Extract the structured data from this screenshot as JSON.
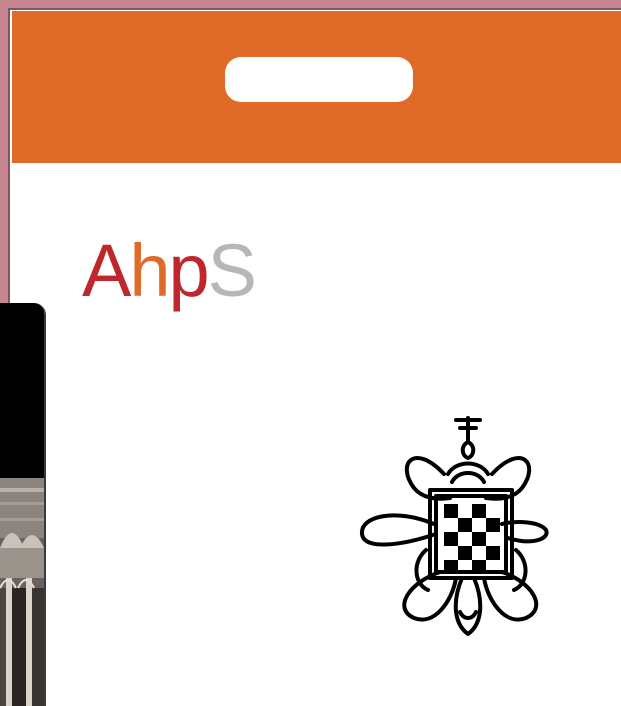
{
  "colors": {
    "page_border": "#c5868f",
    "header_band": "#e06a27",
    "logo_red": "#c0272d",
    "logo_orange": "#e06a27",
    "logo_gray": "#b7b7b7"
  },
  "logo": {
    "letter_1": "A",
    "letter_2": "h",
    "letter_3": "p",
    "letter_4": "S"
  },
  "icons": {
    "emblem": "heraldic-knot-emblem-icon",
    "side_photo": "architecture-arches-image"
  }
}
